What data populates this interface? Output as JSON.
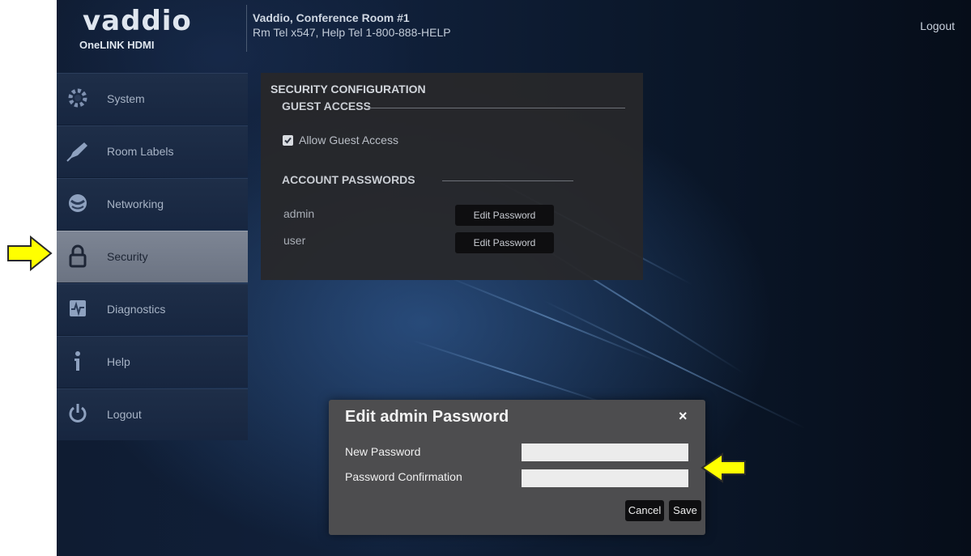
{
  "header": {
    "logo_word": "vaddio",
    "logo_sub": "OneLINK HDMI",
    "room_title": "Vaddio, Conference Room #1",
    "room_info": "Rm Tel x547, Help Tel 1-800-888-HELP",
    "logout_label": "Logout"
  },
  "sidebar": {
    "items": [
      {
        "label": "System",
        "icon": "gear-icon"
      },
      {
        "label": "Room Labels",
        "icon": "pen-icon"
      },
      {
        "label": "Networking",
        "icon": "globe-icon"
      },
      {
        "label": "Security",
        "icon": "lock-icon",
        "active": true
      },
      {
        "label": "Diagnostics",
        "icon": "pulse-icon"
      },
      {
        "label": "Help",
        "icon": "info-icon"
      },
      {
        "label": "Logout",
        "icon": "power-icon"
      }
    ]
  },
  "security": {
    "title": "SECURITY CONFIGURATION",
    "guest_access_heading": "GUEST ACCESS",
    "allow_guest_label": "Allow Guest Access",
    "allow_guest_checked": true,
    "account_passwords_heading": "ACCOUNT PASSWORDS",
    "accounts": [
      {
        "name": "admin",
        "button": "Edit Password"
      },
      {
        "name": "user",
        "button": "Edit Password"
      }
    ]
  },
  "modal": {
    "title": "Edit admin Password",
    "close_symbol": "×",
    "new_password_label": "New Password",
    "new_password_value": "",
    "confirm_label": "Password Confirmation",
    "confirm_value": "",
    "cancel_label": "Cancel",
    "save_label": "Save"
  },
  "colors": {
    "annotation_arrow": "#ffff00",
    "active_nav": "#767e8c",
    "panel_bg": "#28282a"
  }
}
